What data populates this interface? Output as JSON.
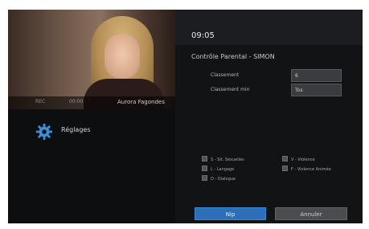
{
  "video": {
    "left_info": "REC",
    "mid_info": "00:00",
    "channel": "Aurora Fagondes"
  },
  "sidebar": {
    "settings_label": "Réglages"
  },
  "header": {
    "time": "09:05",
    "title": "Contrôle Parental - SIMON"
  },
  "fields": [
    {
      "label": "Classement",
      "value": "6"
    },
    {
      "label": "Classement min",
      "value": "Tos"
    }
  ],
  "content_flags": [
    {
      "label": "S - Sit. Sexuelles"
    },
    {
      "label": "V - Violence"
    },
    {
      "label": "L - Langage"
    },
    {
      "label": "F - Violence Animée"
    },
    {
      "label": "D - Dialogue"
    }
  ],
  "buttons": {
    "ok": "Nip",
    "cancel": "Annuler"
  },
  "colors": {
    "accent": "#2c6fb8",
    "background": "#0d0e10"
  }
}
